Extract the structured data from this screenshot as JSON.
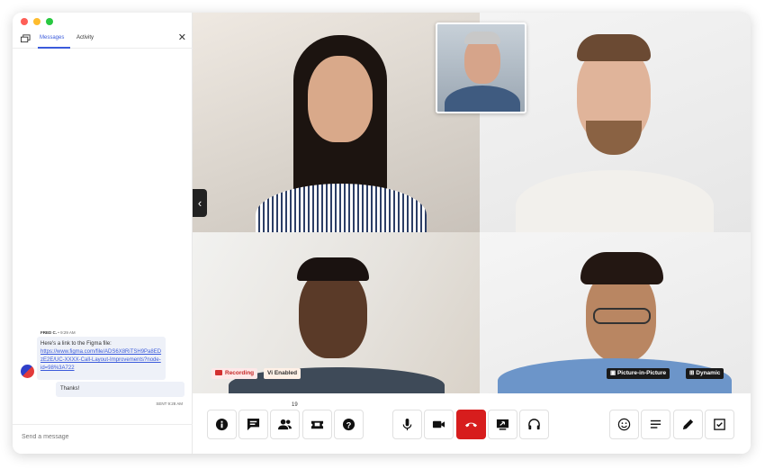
{
  "sidebar": {
    "tabs": [
      {
        "label": "Messages"
      },
      {
        "label": "Activity"
      }
    ],
    "message": {
      "sender": "FRED C.",
      "time": "• 9:29 AM",
      "text": "Here's a link to the Figma file:",
      "link": "https://www.figma.com/file/ADS6X8RiTSH9Pa8EDzE2E/UC-XXXX-Call-Layout-Improvements?node-id=98%3A722"
    },
    "reply": {
      "text": "Thanks!",
      "status": "SENT 9:28 AM"
    },
    "compose": {
      "placeholder": "Send a message"
    }
  },
  "stage": {
    "recording_label": "Recording",
    "vi_label": "Vi",
    "enabled_label": "Enabled",
    "pip_label": "Picture-in-Picture",
    "dynamic_label": "Dynamic"
  },
  "toolbar": {
    "participants_count": "19",
    "buttons": [
      {
        "icon": "info-icon"
      },
      {
        "icon": "chat-icon"
      },
      {
        "icon": "participants-icon"
      },
      {
        "icon": "ticket-icon"
      },
      {
        "icon": "help-icon"
      },
      {
        "icon": "microphone-icon"
      },
      {
        "icon": "camera-icon"
      },
      {
        "icon": "hang-up-icon"
      },
      {
        "icon": "screen-share-icon"
      },
      {
        "icon": "headset-icon"
      },
      {
        "icon": "emoji-icon"
      },
      {
        "icon": "notes-icon"
      },
      {
        "icon": "pencil-icon"
      },
      {
        "icon": "checklist-icon"
      }
    ]
  },
  "colors": {
    "accent": "#3b5bdb",
    "hangup": "#d71d1d",
    "recording": "#c62828"
  }
}
